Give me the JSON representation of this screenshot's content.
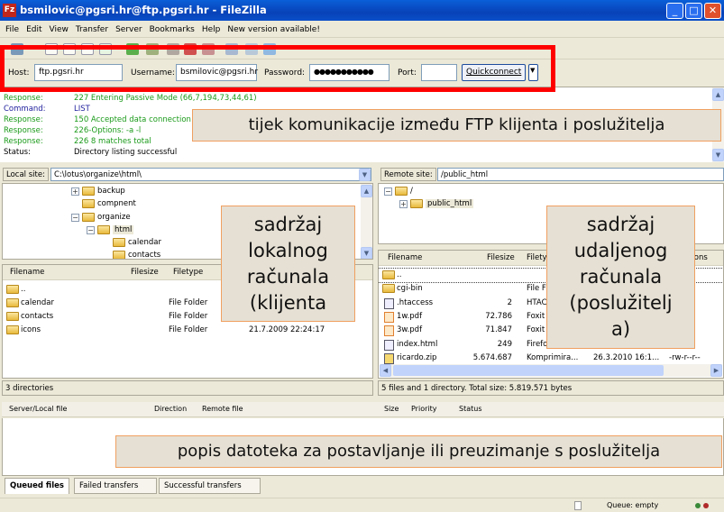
{
  "window": {
    "title": "bsmilovic@pgsri.hr@ftp.pgsri.hr - FileZilla",
    "app_icon": "Fz",
    "controls": [
      "minimize",
      "maximize",
      "close"
    ]
  },
  "menu": [
    "File",
    "Edit",
    "View",
    "Transfer",
    "Server",
    "Bookmarks",
    "Help",
    "New version available!"
  ],
  "quickconnect": {
    "host_label": "Host:",
    "host": "ftp.pgsri.hr",
    "username_label": "Username:",
    "username": "bsmilovic@pgsri.hr",
    "password_label": "Password:",
    "password": "●●●●●●●●●●●",
    "port_label": "Port:",
    "port": "",
    "button": "Quickconnect",
    "highlight_color": "#ff0000"
  },
  "log": [
    {
      "type": "Response:",
      "text": "227 Entering Passive Mode (66,7,194,73,44,61)",
      "color": "#1a9a1a"
    },
    {
      "type": "Command:",
      "text": "LIST",
      "color": "#1c1c9c"
    },
    {
      "type": "Response:",
      "text": "150 Accepted data connection",
      "color": "#1a9a1a"
    },
    {
      "type": "Response:",
      "text": "226-Options: -a -l",
      "color": "#1a9a1a"
    },
    {
      "type": "Response:",
      "text": "226 8 matches total",
      "color": "#1a9a1a"
    },
    {
      "type": "Status:",
      "text": "Directory listing successful",
      "color": "#000000"
    }
  ],
  "annotations": {
    "log": "tijek komunikacije između FTP klijenta i poslužitelja",
    "local": [
      "sadržaj",
      "lokalnog",
      "računala",
      "(klijenta"
    ],
    "remote": [
      "sadržaj",
      "udaljenog",
      "računala",
      "(poslužitelj",
      "a)"
    ],
    "queue": "popis datoteka za postavljanje ili preuzimanje s poslužitelja"
  },
  "local": {
    "site_label": "Local site:",
    "path": "C:\\lotus\\organize\\html\\",
    "tree": [
      {
        "name": "backup",
        "exp": "+"
      },
      {
        "name": "compnent",
        "exp": ""
      },
      {
        "name": "organize",
        "exp": "−"
      },
      {
        "name": "html",
        "exp": "−"
      },
      {
        "name": "calendar",
        "exp": ""
      },
      {
        "name": "contacts",
        "exp": ""
      }
    ],
    "columns": [
      "Filename",
      "Filesize",
      "Filetype"
    ],
    "files": [
      {
        "name": "..",
        "type": "",
        "date": ""
      },
      {
        "name": "calendar",
        "type": "File Folder",
        "date": ""
      },
      {
        "name": "contacts",
        "type": "File Folder",
        "date": ""
      },
      {
        "name": "icons",
        "type": "File Folder",
        "date": "21.7.2009 22:24:17"
      }
    ],
    "status": "3 directories"
  },
  "remote": {
    "site_label": "Remote site:",
    "path": "/public_html",
    "tree": [
      {
        "name": "/",
        "exp": "−"
      },
      {
        "name": "public_html",
        "exp": "+"
      }
    ],
    "columns": [
      "Filename",
      "Filesize",
      "Filety",
      "sions"
    ],
    "files": [
      {
        "name": "..",
        "size": "",
        "type": "",
        "date": "",
        "perm": "",
        "icon": "folder"
      },
      {
        "name": "cgi-bin",
        "size": "",
        "type": "File Fo",
        "date": "",
        "perm": "xr-x",
        "icon": "folder"
      },
      {
        "name": ".htaccess",
        "size": "2",
        "type": "HTAC",
        "date": "",
        "perm": "r--",
        "icon": "doc"
      },
      {
        "name": "1w.pdf",
        "size": "72.786",
        "type": "Foxit I",
        "date": "",
        "perm": "r--",
        "icon": "pdf"
      },
      {
        "name": "3w.pdf",
        "size": "71.847",
        "type": "Foxit I",
        "date": "",
        "perm": "r--",
        "icon": "pdf"
      },
      {
        "name": "index.html",
        "size": "249",
        "type": "Firefo",
        "date": "",
        "perm": "r--",
        "icon": "doc"
      },
      {
        "name": "ricardo.zip",
        "size": "5.674.687",
        "type": "Komprimira...",
        "date": "26.3.2010 16:1...",
        "perm": "-rw-r--r--",
        "icon": "zip"
      }
    ],
    "status": "5 files and 1 directory. Total size: 5.819.571 bytes"
  },
  "queue": {
    "columns": [
      "Server/Local file",
      "Direction",
      "Remote file",
      "Size",
      "Priority",
      "Status"
    ],
    "tabs": [
      "Queued files",
      "Failed transfers",
      "Successful transfers"
    ],
    "status": "Queue: empty"
  }
}
